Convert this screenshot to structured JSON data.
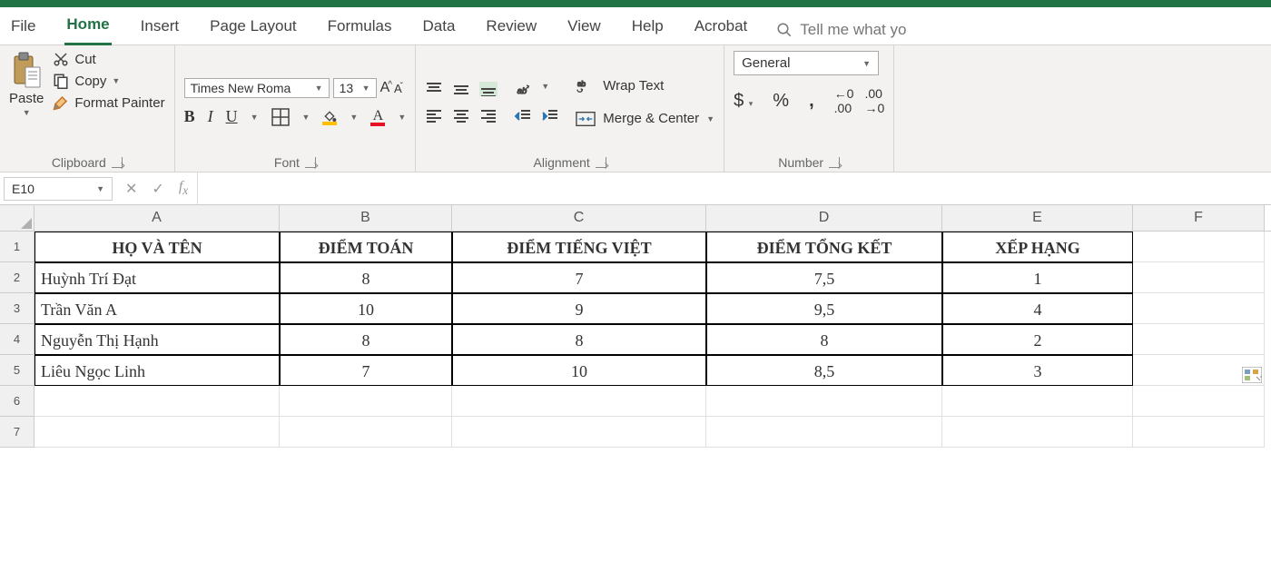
{
  "tabs": {
    "file": "File",
    "home": "Home",
    "insert": "Insert",
    "pagelayout": "Page Layout",
    "formulas": "Formulas",
    "data": "Data",
    "review": "Review",
    "view": "View",
    "help": "Help",
    "acrobat": "Acrobat",
    "tellme": "Tell me what yo"
  },
  "ribbon": {
    "clipboard": {
      "paste": "Paste",
      "cut": "Cut",
      "copy": "Copy",
      "formatpainter": "Format Painter",
      "label": "Clipboard"
    },
    "font": {
      "name": "Times New Roma",
      "size": "13",
      "label": "Font"
    },
    "alignment": {
      "wrap": "Wrap Text",
      "merge": "Merge & Center",
      "label": "Alignment"
    },
    "number": {
      "format": "General",
      "label": "Number"
    }
  },
  "formula_bar": {
    "namebox": "E10",
    "value": ""
  },
  "columns": [
    "A",
    "B",
    "C",
    "D",
    "E",
    "F"
  ],
  "headers": {
    "a": "HỌ VÀ TÊN",
    "b": "ĐIỂM TOÁN",
    "c": "ĐIỂM TIẾNG VIỆT",
    "d": "ĐIỂM TỔNG KẾT",
    "e": "XẾP HẠNG"
  },
  "data_rows": [
    {
      "name": "Huỳnh Trí Đạt",
      "math": "8",
      "viet": "7",
      "total": "7,5",
      "rank": "1"
    },
    {
      "name": "Trần Văn A",
      "math": "10",
      "viet": "9",
      "total": "9,5",
      "rank": "4"
    },
    {
      "name": "Nguyễn Thị Hạnh",
      "math": "8",
      "viet": "8",
      "total": "8",
      "rank": "2"
    },
    {
      "name": "Liêu Ngọc Linh",
      "math": "7",
      "viet": "10",
      "total": "8,5",
      "rank": "3"
    }
  ],
  "row_nums": [
    "1",
    "2",
    "3",
    "4",
    "5",
    "6",
    "7"
  ]
}
